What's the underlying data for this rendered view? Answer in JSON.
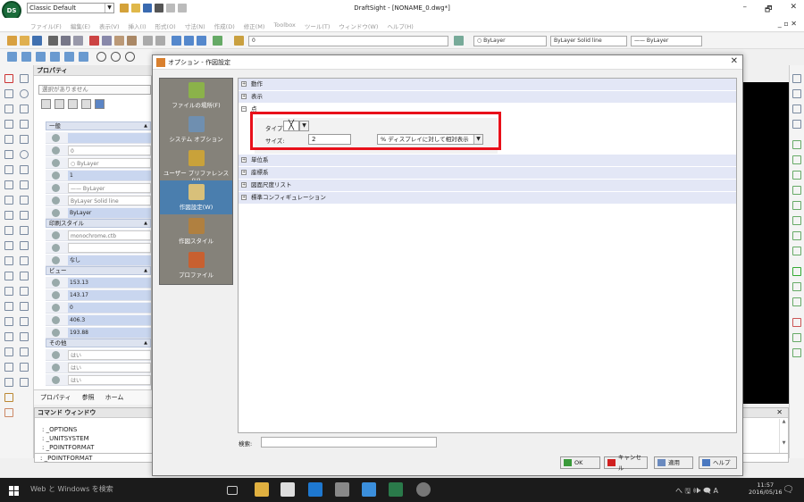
{
  "app": {
    "logo_text": "DS",
    "workspace": "Classic Default",
    "title": "DraftSight - [NONAME_0.dwg*]",
    "win_min": "–",
    "win_max": "🗗",
    "win_close": "✕",
    "mdi_ctrl": "_ ▫ ✕"
  },
  "menus": [
    "ファイル(F)",
    "編集(E)",
    "表示(V)",
    "挿入(I)",
    "形式(O)",
    "寸法(N)",
    "作成(D)",
    "修正(M)",
    "Toolbox",
    "ツール(T)",
    "ウィンドウ(W)",
    "ヘルプ(H)"
  ],
  "toolbar": {
    "layer_value": "0",
    "color_value": "ByLayer",
    "linestyle_value": "ByLayer    Solid line",
    "lineweight_value": "—— ByLayer"
  },
  "properties": {
    "title": "プロパティ",
    "selection": "選択がありません",
    "sec_general": "一般",
    "sec_print": "印刷スタイル",
    "sec_view": "ビュー",
    "sec_other": "その他",
    "general_rows": [
      "",
      "0",
      "○ ByLayer",
      "1",
      "—— ByLayer",
      "ByLayer    Solid line",
      "ByLayer"
    ],
    "print_rows": [
      "monochrome.ctb",
      "",
      "なし"
    ],
    "view_rows": [
      "153.13",
      "143.17",
      "0",
      "406.3",
      "193.88"
    ],
    "other_rows": [
      "はい",
      "はい",
      "はい"
    ],
    "tabs": [
      "プロパティ",
      "参照",
      "ホーム"
    ]
  },
  "command": {
    "title": "コマンド ウィンドウ",
    "close": "✕",
    "lines": [
      ": _OPTIONS",
      ": _UNITSYSTEM",
      ": _POINTFORMAT"
    ],
    "input": ": _POINTFORMAT"
  },
  "dialog": {
    "title": "オプション - 作図設定",
    "close": "✕",
    "nav": [
      {
        "label": "ファイルの場所(F)",
        "color": "#8bb24a"
      },
      {
        "label": "システム オプション",
        "color": "#6f8fb0"
      },
      {
        "label": "ユーザー プリファレンス(U)",
        "color": "#c9a23a"
      },
      {
        "label": "作図設定(W)",
        "color": "#d8c07a"
      },
      {
        "label": "作図スタイル",
        "color": "#b08040"
      },
      {
        "label": "プロファイル",
        "color": "#c86030"
      }
    ],
    "tree": [
      {
        "sign": "+",
        "label": "動作"
      },
      {
        "sign": "+",
        "label": "表示"
      },
      {
        "sign": "−",
        "label": "点"
      },
      {
        "sign": "+",
        "label": "単位系"
      },
      {
        "sign": "+",
        "label": "座標系"
      },
      {
        "sign": "+",
        "label": "図面尺度リスト"
      },
      {
        "sign": "+",
        "label": "標準コンフィギュレーション"
      }
    ],
    "point": {
      "type_label": "タイプ:",
      "type_value": "╳",
      "size_label": "サイズ:",
      "size_value": "2",
      "mode_value": "% ディスプレイに対して相対表示"
    },
    "search_label": "検索:",
    "search_value": "",
    "buttons": {
      "ok": "OK",
      "cancel": "キャンセル",
      "apply": "適用",
      "help": "ヘルプ"
    }
  },
  "taskbar": {
    "search": "Web と Windows を検索",
    "tray": "へ 🖫 🕪 🗨 A",
    "time": "11:57",
    "date": "2016/05/16"
  },
  "colors": {
    "highlight": "#e8101a",
    "selected_nav": "#4a7eae",
    "tree_row": "#e3e7f6",
    "taskbar": "#1b1b1b"
  }
}
